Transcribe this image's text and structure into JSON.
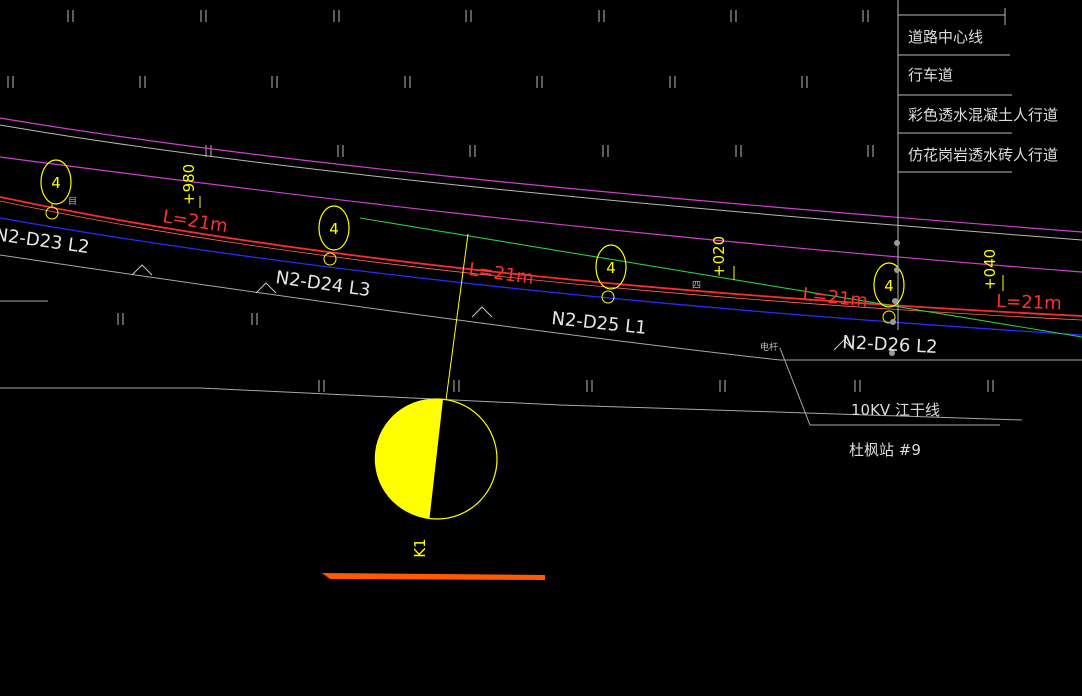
{
  "colors": {
    "background": "#000000",
    "centerline_magenta": "#d040d0",
    "road_edge_gray": "#bfbfbf",
    "cable_red": "#ff2a2a",
    "cable_blue": "#2a2aff",
    "branch_green": "#2ecc40",
    "marker_yellow": "#ffff00",
    "legend_white": "#dcdcdc",
    "slab_orange": "#ff5a00"
  },
  "legend": {
    "items": [
      "道路中心线",
      "行车道",
      "彩色透水混凝土人行道",
      "仿花岗岩透水砖人行道"
    ]
  },
  "poles": [
    {
      "id": "N2-D23 L2",
      "marker": "4"
    },
    {
      "id": "N2-D24 L3",
      "marker": "4"
    },
    {
      "id": "N2-D25 L1",
      "marker": "4"
    },
    {
      "id": "N2-D26 L2",
      "marker": "4"
    }
  ],
  "span_labels": [
    "L=21m",
    "L=21m",
    "L=21m",
    "L=21m"
  ],
  "chainage_labels": [
    "+980",
    "+020",
    "+040"
  ],
  "powerline_label": "10KV 江干线",
  "substation_label": "杜枫站 #9",
  "k_label": "K1",
  "small_label": "电杆",
  "tiny_mark": "目",
  "tiny_mark2": "四"
}
